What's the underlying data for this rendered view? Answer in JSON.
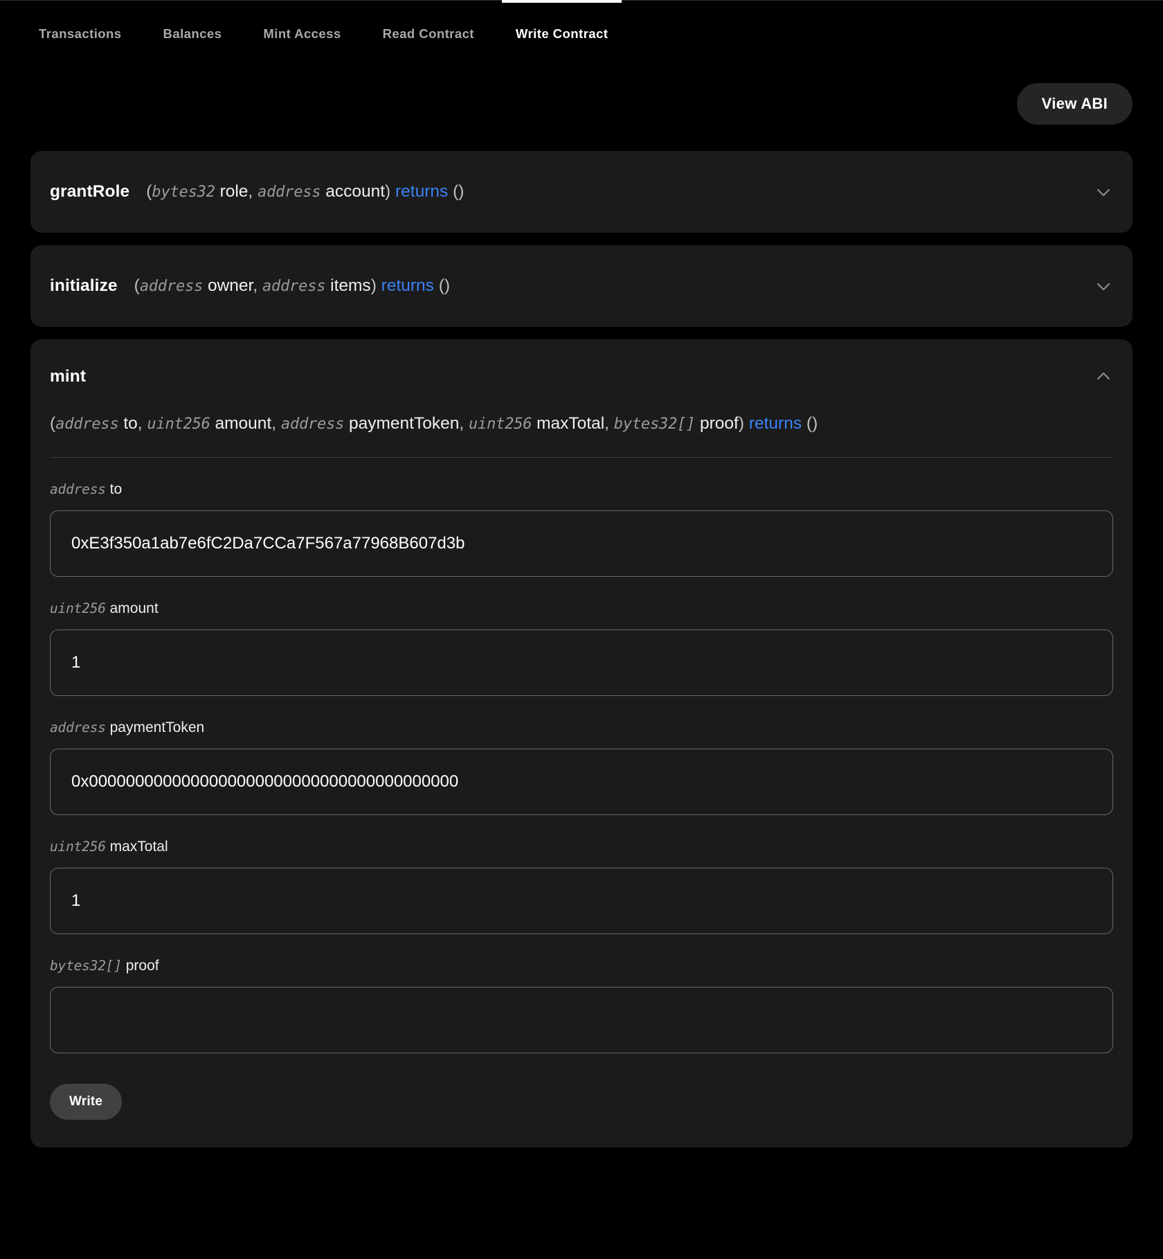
{
  "tabs": [
    {
      "label": "Transactions",
      "active": false
    },
    {
      "label": "Balances",
      "active": false
    },
    {
      "label": "Mint Access",
      "active": false
    },
    {
      "label": "Read Contract",
      "active": false
    },
    {
      "label": "Write Contract",
      "active": true
    }
  ],
  "toolbar": {
    "view_abi_label": "View ABI"
  },
  "colors": {
    "page_background": "#000000",
    "card_background": "#1b1b1b",
    "returns_accent": "#3b82f6",
    "type_text": "#9b9b9b",
    "active_tab_indicator": "#ffffff",
    "write_button_background": "#414141",
    "abi_button_background": "#252525"
  },
  "functions": [
    {
      "name": "grantRole",
      "expanded": false,
      "chevron": "chevron-down-icon",
      "signature": {
        "open_paren": "(",
        "params": [
          {
            "type": "bytes32",
            "name": "role"
          },
          {
            "type": "address",
            "name": "account"
          }
        ],
        "close_paren": ")",
        "returns_keyword": "returns",
        "returns_value": "()"
      }
    },
    {
      "name": "initialize",
      "expanded": false,
      "chevron": "chevron-down-icon",
      "signature": {
        "open_paren": "(",
        "params": [
          {
            "type": "address",
            "name": "owner"
          },
          {
            "type": "address",
            "name": "items"
          }
        ],
        "close_paren": ")",
        "returns_keyword": "returns",
        "returns_value": "()"
      }
    },
    {
      "name": "mint",
      "expanded": true,
      "chevron": "chevron-up-icon",
      "signature": {
        "open_paren": "(",
        "params": [
          {
            "type": "address",
            "name": "to"
          },
          {
            "type": "uint256",
            "name": "amount"
          },
          {
            "type": "address",
            "name": "paymentToken"
          },
          {
            "type": "uint256",
            "name": "maxTotal"
          },
          {
            "type": "bytes32[]",
            "name": "proof"
          }
        ],
        "close_paren": ")",
        "returns_keyword": "returns",
        "returns_value": "()"
      },
      "fields": [
        {
          "type": "address",
          "name": "to",
          "value": "0xE3f350a1ab7e6fC2Da7CCa7F567a77968B607d3b",
          "placeholder": ""
        },
        {
          "type": "uint256",
          "name": "amount",
          "value": "1",
          "placeholder": ""
        },
        {
          "type": "address",
          "name": "paymentToken",
          "value": "0x0000000000000000000000000000000000000000",
          "placeholder": ""
        },
        {
          "type": "uint256",
          "name": "maxTotal",
          "value": "1",
          "placeholder": ""
        },
        {
          "type": "bytes32[]",
          "name": "proof",
          "value": "",
          "placeholder": ""
        }
      ],
      "submit_label": "Write"
    }
  ]
}
